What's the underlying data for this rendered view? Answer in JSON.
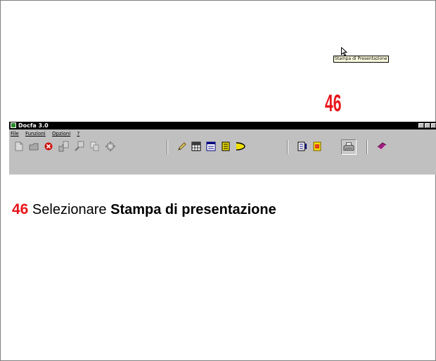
{
  "slide": {
    "step_number": "46",
    "caption": {
      "number": "46",
      "text": "Selezionare",
      "bold_text": "Stampa di presentazione"
    }
  },
  "window": {
    "title": "Docfa 3.0",
    "menu": [
      "File",
      "Funzioni",
      "Opzioni",
      "?"
    ],
    "tooltip": "Stampa di Presentazione"
  },
  "colors": {
    "accent_red": "#e8141b",
    "window_gray": "#c0c0c0",
    "titlebar": "#000000",
    "tooltip_bg": "#ffffe1"
  },
  "toolbar_icons": [
    "new-document-icon",
    "open-icon",
    "delete-icon",
    "export-icon",
    "import-icon",
    "copy-icon",
    "settings-icon",
    "edit-icon",
    "grid-icon",
    "form-icon",
    "list-icon",
    "curve-icon",
    "report-icon",
    "notes-icon",
    "printer-icon",
    "help-book-icon"
  ]
}
